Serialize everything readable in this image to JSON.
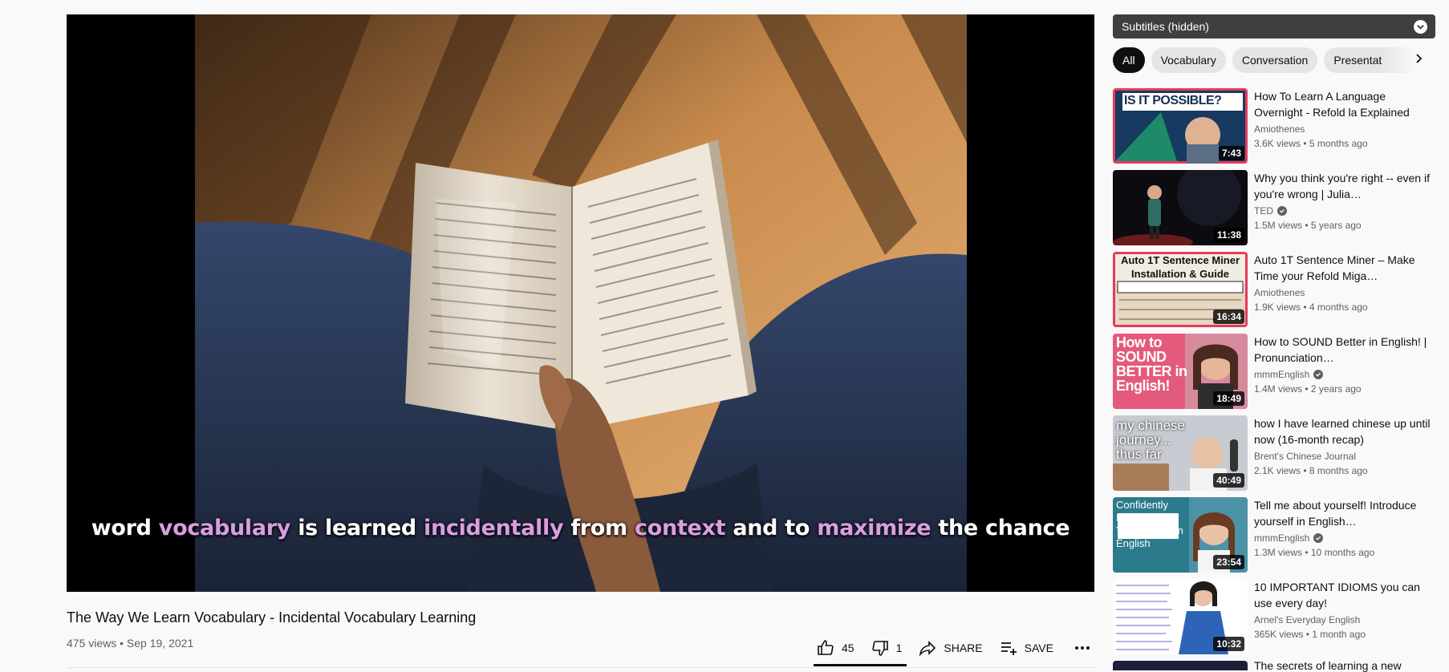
{
  "player": {
    "caption": [
      {
        "text": "word ",
        "hl": false
      },
      {
        "text": "vocabulary",
        "hl": true
      },
      {
        "text": " is learned ",
        "hl": false
      },
      {
        "text": "incidentally",
        "hl": true
      },
      {
        "text": " from ",
        "hl": false
      },
      {
        "text": "context",
        "hl": true
      },
      {
        "text": " and to ",
        "hl": false
      },
      {
        "text": "maximize",
        "hl": true
      },
      {
        "text": " the chance",
        "hl": false
      }
    ]
  },
  "video": {
    "title": "The Way We Learn Vocabulary - Incidental Vocabulary Learning",
    "meta": "475 views • Sep 19, 2021"
  },
  "actions": {
    "like_count": "45",
    "dislike_count": "1",
    "share_label": "SHARE",
    "save_label": "SAVE"
  },
  "sidebar": {
    "subtitles_label": "Subtitles (hidden)",
    "chips": [
      "All",
      "Vocabulary",
      "Conversation",
      "Presentat"
    ],
    "recommendations": [
      {
        "title": "How To Learn A Language Overnight - Refold la Explained",
        "channel": "Amiothenes",
        "verified": false,
        "stats": "3.6K views • 5 months ago",
        "duration": "7:43",
        "thumb_text": "IS IT POSSIBLE?"
      },
      {
        "title": "Why you think you're right -- even if you're wrong | Julia…",
        "channel": "TED",
        "verified": true,
        "stats": "1.5M views • 5 years ago",
        "duration": "11:38",
        "thumb_text": ""
      },
      {
        "title": "Auto 1T Sentence Miner – Make Time your Refold Miga…",
        "channel": "Amiothenes",
        "verified": false,
        "stats": "1.9K views • 4 months ago",
        "duration": "16:34",
        "thumb_text": "Auto 1T Sentence Miner Installation & Guide"
      },
      {
        "title": "How to SOUND Better in English! | Pronunciation…",
        "channel": "mmmEnglish",
        "verified": true,
        "stats": "1.4M views • 2 years ago",
        "duration": "18:49",
        "thumb_text": "How to SOUND BETTER in English!"
      },
      {
        "title": "how I have learned chinese up until now (16-month recap)",
        "channel": "Brent's Chinese Journal",
        "verified": false,
        "stats": "2.1K views • 8 months ago",
        "duration": "40:49",
        "thumb_text": "my chinese journey... thus far"
      },
      {
        "title": "Tell me about yourself! Introduce yourself in English…",
        "channel": "mmmEnglish",
        "verified": true,
        "stats": "1.3M views • 10 months ago",
        "duration": "23:54",
        "thumb_text": "Confidently INTRODUCE YOURSELF in English"
      },
      {
        "title": "10 IMPORTANT IDIOMS you can use every day!",
        "channel": "Arnel's Everyday English",
        "verified": false,
        "stats": "365K views • 1 month ago",
        "duration": "10:32",
        "thumb_text": ""
      }
    ],
    "next_partial_title": "The secrets of learning a new"
  }
}
